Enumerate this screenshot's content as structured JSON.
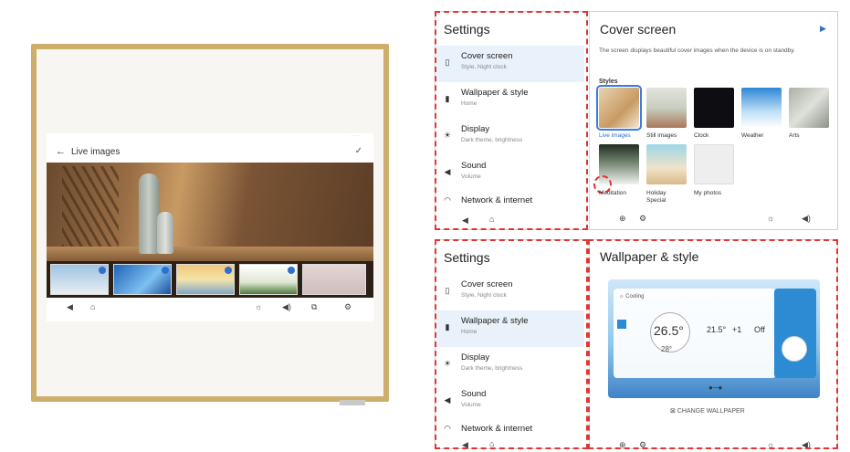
{
  "device": {
    "live_header": "Live images",
    "back_arrow": "←",
    "check_mark": "✓",
    "status_text": "· · ·",
    "nav": {
      "back": "◀",
      "home": "⌂",
      "brightness": "☼",
      "volume": "◀)",
      "mirror": "⧉",
      "settings": "⚙"
    }
  },
  "panel_top": {
    "title": "Settings",
    "menu": [
      {
        "label": "Cover screen",
        "sub": "Style, Night clock",
        "icon": "cover-icon",
        "glyph": "▯"
      },
      {
        "label": "Wallpaper & style",
        "sub": "Home",
        "icon": "wallpaper-icon",
        "glyph": "▮"
      },
      {
        "label": "Display",
        "sub": "Dark theme, brightness",
        "icon": "brightness-icon",
        "glyph": "☀"
      },
      {
        "label": "Sound",
        "sub": "Volume",
        "icon": "sound-icon",
        "glyph": "◀"
      },
      {
        "label": "Network & internet",
        "sub": "",
        "icon": "wifi-icon",
        "glyph": "◠"
      }
    ],
    "selected_index": 0,
    "content_title": "Cover screen",
    "play_icon": "▶",
    "description": "The screen displays beautiful cover images when the device is on standby.",
    "styles_label": "Styles",
    "styles": [
      "Live images",
      "Still images",
      "Clock",
      "Weather",
      "Arts",
      "Meditation",
      "Holiday Special",
      "My photos"
    ],
    "selected_style": 0,
    "nav": {
      "back": "◀",
      "home": "⌂",
      "a1": "⊕",
      "a2": "⚙",
      "brightness": "☼",
      "volume": "◀)"
    }
  },
  "panel_bottom": {
    "title": "Settings",
    "menu": [
      {
        "label": "Cover screen",
        "sub": "Style, Night clock",
        "icon": "cover-icon",
        "glyph": "▯"
      },
      {
        "label": "Wallpaper & style",
        "sub": "Home",
        "icon": "wallpaper-icon",
        "glyph": "▮"
      },
      {
        "label": "Display",
        "sub": "Dark theme, brightness",
        "icon": "brightness-icon",
        "glyph": "☀"
      },
      {
        "label": "Sound",
        "sub": "Volume",
        "icon": "sound-icon",
        "glyph": "◀"
      },
      {
        "label": "Network & internet",
        "sub": "",
        "icon": "wifi-icon",
        "glyph": "◠"
      }
    ],
    "selected_index": 1,
    "content_title": "Wallpaper & style",
    "preview": {
      "mode": "☼ Cooling",
      "temp_main": "26.5°",
      "temp_sub": "28°",
      "set_temp": "21.5°",
      "fan": "+1",
      "state": "Off"
    },
    "change_label": "⊠ CHANGE WALLPAPER",
    "nav": {
      "back": "◀",
      "home": "⌂",
      "a1": "⊕",
      "a2": "⚙",
      "brightness": "☼",
      "volume": "◀)"
    }
  },
  "colors": {
    "dashed": "#e03535",
    "frame": "#cfae6c",
    "selected": "#e9f1fb",
    "accent": "#3b7be0"
  }
}
